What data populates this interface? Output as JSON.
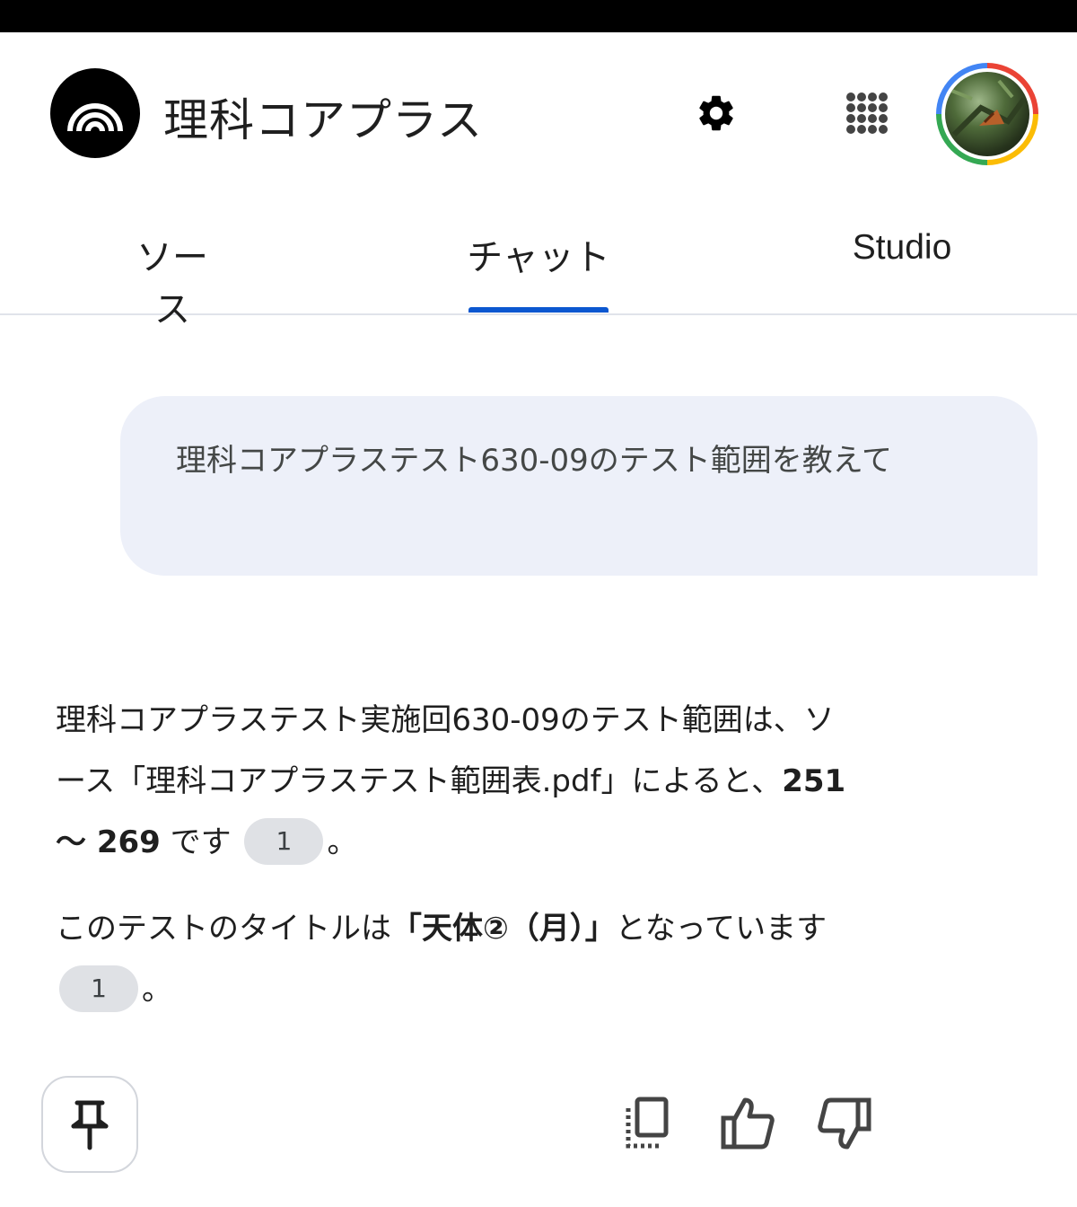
{
  "header": {
    "app_title": "理科コアプラス",
    "icons": [
      "logo-icon",
      "gear-icon",
      "apps-grid-icon",
      "avatar"
    ]
  },
  "tabs": [
    {
      "label": "ソース",
      "selected": false
    },
    {
      "label": "チャット",
      "selected": true
    },
    {
      "label": "Studio",
      "selected": false
    }
  ],
  "accent_color": "#0b57d0",
  "chat": {
    "user_message": "理科コアプラステスト630-09のテスト範囲を教えて",
    "answer": {
      "p1_before": "理科コアプラステスト実施回630-09のテスト範囲は、ソース「理科コアプラステスト範囲表.pdf」によると、",
      "p1_bold": "251 〜 269",
      "p1_after": " です",
      "p1_citation": "1",
      "p1_end": "。",
      "p2_before": "このテストのタイトルは",
      "p2_bold": "「天体②（月）」",
      "p2_after": "となっています",
      "p2_citation": "1",
      "p2_end": "。"
    }
  },
  "actions": {
    "icons": [
      "pin-icon",
      "copy-icon",
      "thumbs-up-icon",
      "thumbs-down-icon"
    ]
  }
}
